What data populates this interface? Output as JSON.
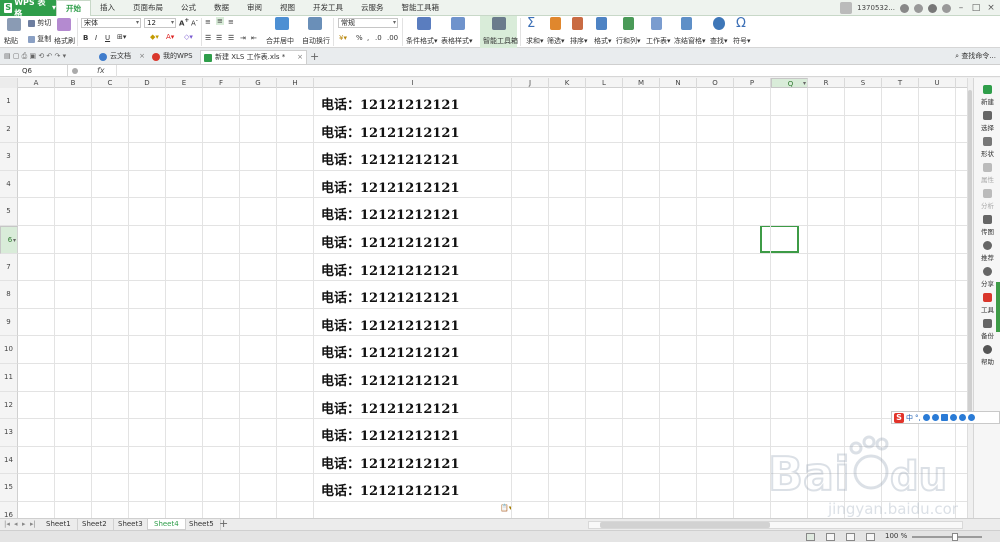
{
  "app": {
    "name": "WPS 表格",
    "user": "1370532...",
    "menu_tabs": [
      "开始",
      "插入",
      "页面布局",
      "公式",
      "数据",
      "审阅",
      "视图",
      "开发工具",
      "云服务",
      "智能工具箱"
    ],
    "active_tab": "开始"
  },
  "ribbon": {
    "cut": "剪切",
    "paste": "粘贴",
    "copy": "复制",
    "format_painter": "格式刷",
    "font_name": "宋体",
    "font_size": "12",
    "merge_center": "合并居中",
    "auto_wrap": "自动换行",
    "number_format": "常规",
    "conditional_format": "条件格式",
    "table_style": "表格样式",
    "smart_toolbox": "智能工具箱",
    "sum": "求和",
    "filter": "筛选",
    "sort": "排序",
    "format": "格式",
    "row_col": "行和列",
    "worksheet": "工作表",
    "freeze": "冻结窗格",
    "find": "查找",
    "symbol": "符号",
    "percent": "%"
  },
  "doc_tabs": [
    {
      "label": "云文档"
    },
    {
      "label": "我的WPS"
    },
    {
      "label": "新建 XLS 工作表.xls *"
    }
  ],
  "search_command": "查找命令...",
  "formula_bar": {
    "cell_ref": "Q6",
    "fx": "fx",
    "content": ""
  },
  "columns": [
    "A",
    "B",
    "C",
    "D",
    "E",
    "F",
    "G",
    "H",
    "I",
    "J",
    "K",
    "L",
    "M",
    "N",
    "O",
    "P",
    "Q",
    "R",
    "S",
    "T",
    "U"
  ],
  "selected_column": "Q",
  "rows": [
    "1",
    "2",
    "3",
    "4",
    "5",
    "6",
    "7",
    "8",
    "9",
    "10",
    "11",
    "12",
    "13",
    "14",
    "15",
    "16"
  ],
  "selected_row": "6",
  "cells_I": [
    "电话：12121212121",
    "电话：12121212121",
    "电话：12121212121",
    "电话：12121212121",
    "电话：12121212121",
    "电话：12121212121",
    "电话：12121212121",
    "电话：12121212121",
    "电话：12121212121",
    "电话：12121212121",
    "电话：12121212121",
    "电话：12121212121",
    "电话：12121212121",
    "电话：12121212121",
    "电话：12121212121"
  ],
  "side_panel": [
    "新建",
    "选择",
    "形状",
    "属性",
    "分析",
    "传图",
    "推荐",
    "分享",
    "工具",
    "备份",
    "帮助"
  ],
  "ime": {
    "lang": "中"
  },
  "sheets": [
    "Sheet1",
    "Sheet2",
    "Sheet3",
    "Sheet4",
    "Sheet5"
  ],
  "active_sheet": "Sheet4",
  "status": {
    "zoom": "100 %"
  },
  "colors": {
    "accent": "#2f9e4a",
    "selection": "#3d9b46"
  }
}
